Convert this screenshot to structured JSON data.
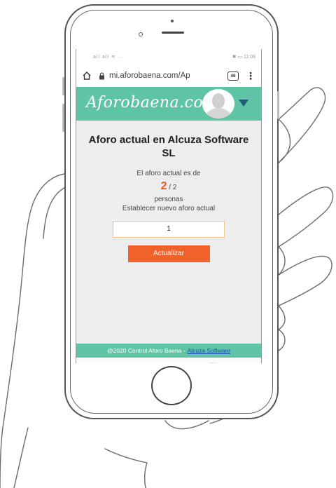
{
  "statusbar": {
    "left": "all all ≋ ..",
    "right": "✱ ▭ 11:08"
  },
  "browser": {
    "url": "mi.aforobaena.com/Ap",
    "tabs_count": "46",
    "menu": "⋮"
  },
  "site": {
    "logo": "Aforobaena.com"
  },
  "page": {
    "title": "Aforo actual en Alcuza Software SL",
    "current_label": "El aforo actual es de",
    "current_value": "2",
    "capacity": "/ 2",
    "unit": "personas",
    "set_label": "Establecer nuevo aforo actual",
    "input_value": "1",
    "update_button": "Actualizar"
  },
  "footer": {
    "text": "@2020 Control Aforo Baena -",
    "link": "Alcuza Software"
  },
  "nav": {
    "back": "◁",
    "home": "○",
    "recents": "□"
  },
  "colors": {
    "brand_green": "#5fc4a5",
    "accent_orange": "#f0612b",
    "caret_blue": "#215e75"
  }
}
